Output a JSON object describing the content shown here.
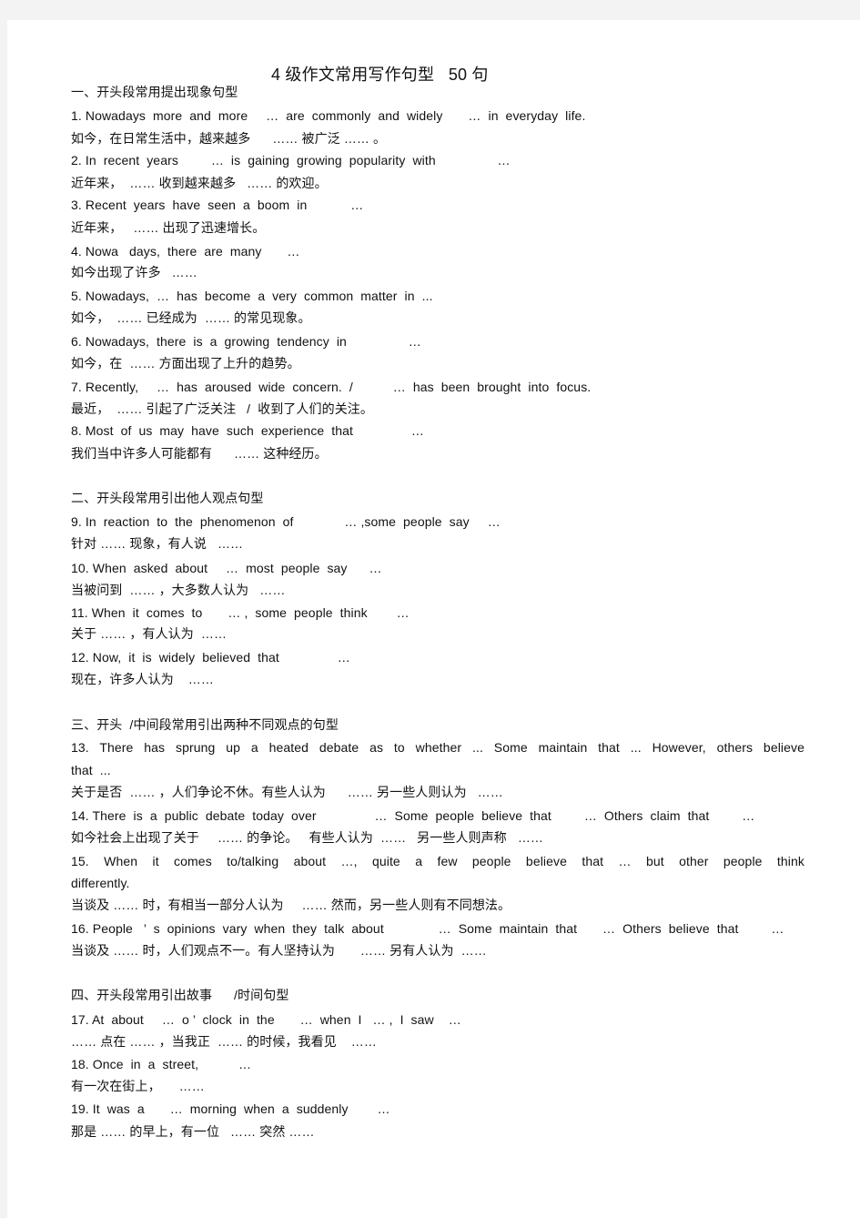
{
  "document": {
    "title": "4 级作文常用写作句型   50 句",
    "lines": [
      {
        "text": "一、开头段常用提出现象句型",
        "kind": "heading"
      },
      {
        "text": "1. Nowadays  more  and  more     …  are  commonly  and  widely       …  in  everyday  life.",
        "kind": "en"
      },
      {
        "text": "如今，在日常生活中，越来越多      …… 被广泛 …… 。",
        "kind": "zh"
      },
      {
        "text": "2. In  recent  years         …  is  gaining  growing  popularity  with                 …",
        "kind": "en"
      },
      {
        "text": "近年来，  …… 收到越来越多   …… 的欢迎。",
        "kind": "zh"
      },
      {
        "text": "3. Recent  years  have  seen  a  boom  in            …",
        "kind": "en"
      },
      {
        "text": "近年来，   …… 出现了迅速增长。",
        "kind": "zh"
      },
      {
        "text": "4. Nowa   days,  there  are  many       …",
        "kind": "en"
      },
      {
        "text": "如今出现了许多   ……",
        "kind": "zh"
      },
      {
        "text": "5. Nowadays,  …  has  become  a  very  common  matter  in  ...",
        "kind": "en"
      },
      {
        "text": "如今，  …… 已经成为  …… 的常见现象。",
        "kind": "zh"
      },
      {
        "text": "6. Nowadays,  there  is  a  growing  tendency  in                 …",
        "kind": "en"
      },
      {
        "text": "如今，在  …… 方面出现了上升的趋势。",
        "kind": "zh"
      },
      {
        "text": "7. Recently,     …  has  aroused  wide  concern.  /           …  has  been  brought  into  focus.",
        "kind": "en"
      },
      {
        "text": "最近，  …… 引起了广泛关注   /  收到了人们的关注。",
        "kind": "zh"
      },
      {
        "text": "8. Most  of  us  may  have  such  experience  that                …",
        "kind": "en"
      },
      {
        "text": "我们当中许多人可能都有      …… 这种经历。",
        "kind": "zh"
      },
      {
        "text": "二、开头段常用引出他人观点句型",
        "kind": "heading"
      },
      {
        "text": "9. In  reaction  to  the  phenomenon  of              … ,some  people  say     …",
        "kind": "en"
      },
      {
        "text": "针对 …… 现象，有人说   ……",
        "kind": "zh"
      },
      {
        "text": "10. When  asked  about     …  most  people  say      …",
        "kind": "en"
      },
      {
        "text": "当被问到  …… ，大多数人认为   ……",
        "kind": "zh"
      },
      {
        "text": "11. When  it  comes  to       … ,  some  people  think        …",
        "kind": "en"
      },
      {
        "text": "关于 …… ，有人认为  ……",
        "kind": "zh"
      },
      {
        "text": "12. Now,  it  is  widely  believed  that                …",
        "kind": "en"
      },
      {
        "text": "现在，许多人认为    ……",
        "kind": "zh"
      },
      {
        "text": "三、开头  /中间段常用引出两种不同观点的句型",
        "kind": "heading"
      },
      {
        "text": "13. There has sprung up a heated debate as to whether ... Some maintain that ... However, others believe",
        "kind": "en-justify"
      },
      {
        "text": "that  ...",
        "kind": "en"
      },
      {
        "text": "关于是否  …… ，人们争论不休。有些人认为      …… 另一些人则认为   ……",
        "kind": "zh"
      },
      {
        "text": "14. There  is  a  public  debate  today  over                …  Some  people  believe  that         …  Others  claim  that         …",
        "kind": "en"
      },
      {
        "text": "如今社会上出现了关于     …… 的争论。   有些人认为  ……   另一些人则声称   ……",
        "kind": "zh"
      },
      {
        "text": "15. When it comes to/talking about …, quite a few people believe that … but other people think",
        "kind": "en-justify"
      },
      {
        "text": "differently.",
        "kind": "en"
      },
      {
        "text": "当谈及 …… 时，有相当一部分人认为     …… 然而，另一些人则有不同想法。",
        "kind": "zh"
      },
      {
        "text": "16. People   ’  s  opinions  vary  when  they  talk  about               …  Some  maintain  that       …  Others  believe  that         …",
        "kind": "en"
      },
      {
        "text": "当谈及 …… 时，人们观点不一。有人坚持认为       …… 另有人认为  ……",
        "kind": "zh"
      },
      {
        "text": "四、开头段常用引出故事      /时间句型",
        "kind": "heading"
      },
      {
        "text": "17. At  about     …  o ’  clock  in  the       …  when  I   … ,  I  saw    …",
        "kind": "en"
      },
      {
        "text": "…… 点在 …… ，当我正  …… 的时候，我看见    ……",
        "kind": "zh"
      },
      {
        "text": "18. Once  in  a  street,           …",
        "kind": "en"
      },
      {
        "text": "有一次在街上，     ……",
        "kind": "zh"
      },
      {
        "text": "19. It  was  a       …  morning  when  a  suddenly        …",
        "kind": "en"
      },
      {
        "text": "那是 …… 的早上，有一位   …… 突然 ……",
        "kind": "zh"
      }
    ]
  }
}
